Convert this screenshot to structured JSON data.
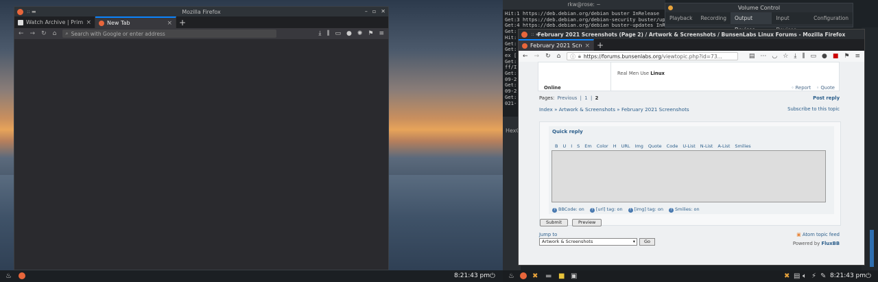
{
  "left_window": {
    "title": "Mozilla Firefox",
    "tabs": [
      {
        "label": "Watch Archive | Prime Vid",
        "active": false
      },
      {
        "label": "New Tab",
        "active": true
      }
    ],
    "url_placeholder": "Search with Google or enter address"
  },
  "terminal": {
    "title": "rkw@rose: ~",
    "lines": [
      "Hit:1 https://deb.debian.org/debian buster InRelease",
      "Get:3 https://deb.debian.org/debian-security buster/up",
      "Get:4 https://deb.debian.org/debian buster-updates InR",
      "Get:",
      "Hit:",
      "Get:",
      "Get:",
      "ex [",
      "Get:",
      "ff/I",
      "Get:",
      "09-2",
      "Get:",
      "09-2",
      "Get:",
      "021-"
    ]
  },
  "volume": {
    "title": "Volume Control",
    "tabs": [
      "Playback",
      "Recording",
      "Output Devices",
      "Input Devices",
      "Configuration"
    ],
    "active_tab": "Output Devices"
  },
  "hexchat": {
    "title": "HexC"
  },
  "forum_window": {
    "title": "February 2021 Screenshots (Page 2) / Artwork & Screenshots / BunsenLabs Linux Forums - Mozilla Firefox",
    "tab_label": "February 2021 Screensh",
    "url_host": "https://forums.bunsenlabs.org",
    "url_path": "/viewtopic.php?id=73..."
  },
  "forum": {
    "signature_prefix": "Real Men Use",
    "signature_bold": "Linux",
    "online": "Online",
    "report": "Report",
    "quote": "Quote",
    "pages_label": "Pages:",
    "pages_prev": "Previous",
    "pages_1": "1",
    "pages_2": "2",
    "post_reply": "Post reply",
    "breadcrumb": "Index » Artwork & Screenshots » February 2021 Screenshots",
    "subscribe": "Subscribe to this topic",
    "quick_reply": "Quick reply",
    "bbcodes": [
      "B",
      "U",
      "I",
      "S",
      "Em",
      "Color",
      "H",
      "URL",
      "Img",
      "Quote",
      "Code",
      "U-List",
      "N-List",
      "A-List",
      "Smilies"
    ],
    "bbstatus": [
      "BBCode: on",
      "[url] tag: on",
      "[img] tag: on",
      "Smilies: on"
    ],
    "submit": "Submit",
    "preview": "Preview",
    "jump_to": "Jump to",
    "jump_value": "Artwork & Screenshots",
    "go": "Go",
    "atom": "Atom topic feed",
    "powered_by": "Powered by",
    "fluxbb": "FluxBB"
  },
  "taskbar": {
    "clock_left": "8:21:43 pm",
    "clock_right": "8:21:43 pm"
  }
}
